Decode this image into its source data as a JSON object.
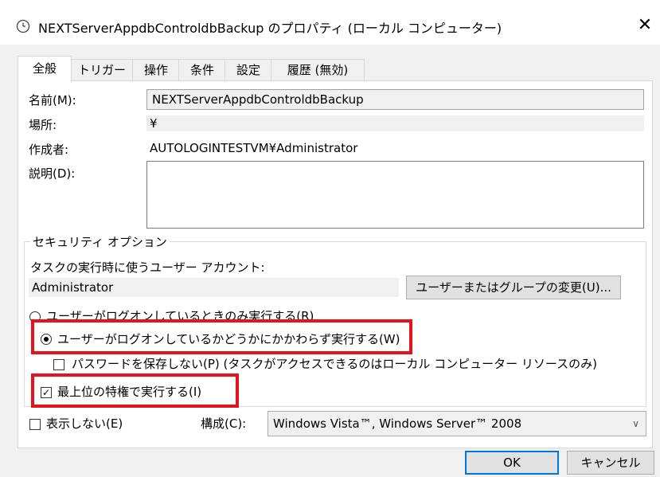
{
  "window": {
    "title": "NEXTServerAppdbControldbBackup のプロパティ (ローカル コンピューター)",
    "close_glyph": "✕",
    "icon": "clock-icon"
  },
  "tabs": [
    {
      "label": "全般",
      "active": true
    },
    {
      "label": "トリガー",
      "active": false
    },
    {
      "label": "操作",
      "active": false
    },
    {
      "label": "条件",
      "active": false
    },
    {
      "label": "設定",
      "active": false
    },
    {
      "label": "履歴 (無効)",
      "active": false
    }
  ],
  "general": {
    "name_label": "名前(M):",
    "name_value": "NEXTServerAppdbControldbBackup",
    "location_label": "場所:",
    "location_value": "¥",
    "author_label": "作成者:",
    "author_value": "AUTOLOGINTESTVM¥Administrator",
    "description_label": "説明(D):",
    "description_value": ""
  },
  "security": {
    "group_title": "セキュリティ オプション",
    "account_prompt": "タスクの実行時に使うユーザー アカウント:",
    "account_value": "Administrator",
    "change_button": "ユーザーまたはグループの変更(U)...",
    "radio_logged_on": "ユーザーがログオンしているときのみ実行する(R)",
    "radio_whether": "ユーザーがログオンしているかどうかにかかわらず実行する(W)",
    "no_store_password": "パスワードを保存しない(P) (タスクがアクセスできるのはローカル コンピューター リソースのみ)",
    "highest_privileges": "最上位の特権で実行する(I)",
    "selected_radio": "whether",
    "no_store_password_checked": false,
    "highest_privileges_checked": true
  },
  "footer": {
    "hidden_label": "表示しない(E)",
    "hidden_checked": false,
    "config_label": "構成(C):",
    "config_value": "Windows Vista™, Windows Server™ 2008"
  },
  "buttons": {
    "ok": "OK",
    "cancel": "キャンセル"
  },
  "colors": {
    "highlight": "#e3141c",
    "focus": "#0078d7"
  }
}
